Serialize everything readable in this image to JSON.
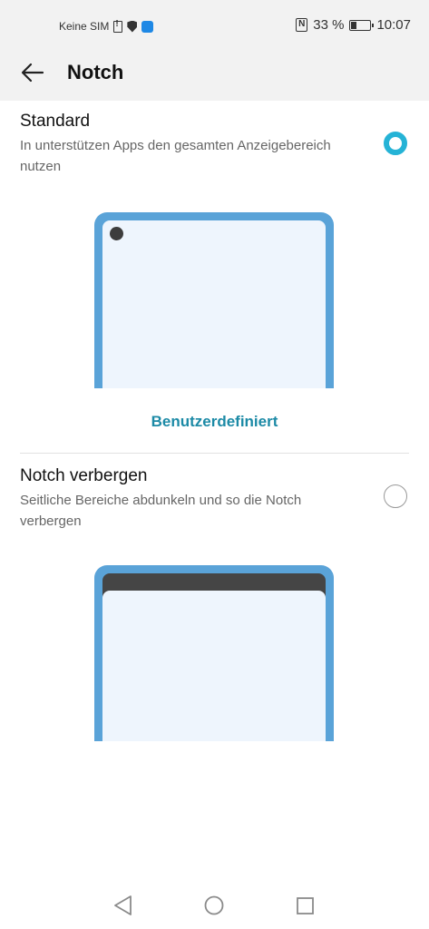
{
  "status_bar": {
    "carrier": "Keine SIM",
    "battery": "33 %",
    "time": "10:07",
    "icons": [
      "sim-alert-icon",
      "shield-icon",
      "app-icon",
      "nfc-icon",
      "battery-icon"
    ]
  },
  "header": {
    "title": "Notch",
    "back_icon": "arrow-left-icon"
  },
  "options": {
    "standard": {
      "title": "Standard",
      "description": "In unterstützen Apps den gesamten Anzeigebereich nutzen",
      "selected": true
    },
    "custom_link": "Benutzerdefiniert",
    "hide": {
      "title": "Notch verbergen",
      "description": "Seitliche Bereiche abdunkeln und so die Notch verbergen",
      "selected": false
    }
  },
  "nav_bar": {
    "back": "triangle-back-icon",
    "home": "circle-home-icon",
    "recents": "square-recents-icon"
  },
  "colors": {
    "accent": "#25b3d6",
    "link": "#1c8aa6",
    "phone_frame": "#5aa3d8",
    "phone_screen": "#eef5fd",
    "header_bg": "#f2f2f2"
  }
}
